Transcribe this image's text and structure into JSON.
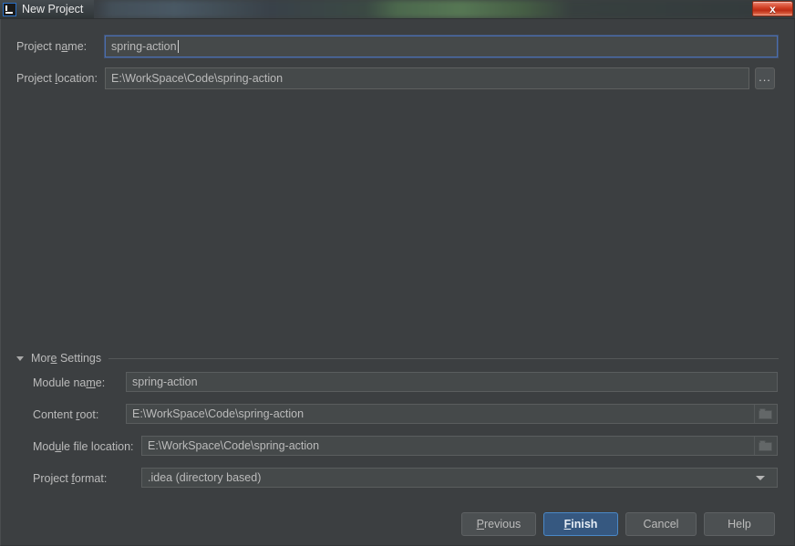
{
  "window": {
    "title": "New Project",
    "app_icon": "intellij-idea-icon",
    "close_label": "x",
    "colors": {
      "dialog_bg": "#3c3f41",
      "field_bg": "#45494a",
      "text": "#bbbbbb",
      "focus_border": "#4b6eaf",
      "primary_button": "#365880",
      "close_button": "#cf3b21"
    }
  },
  "top_form": {
    "project_name": {
      "label_before": "Project n",
      "label_mnemonic": "a",
      "label_after": "me:",
      "label_full": "Project name:",
      "value": "spring-action",
      "focused": true
    },
    "project_location": {
      "label_before": "Project ",
      "label_mnemonic": "l",
      "label_after": "ocation:",
      "label_full": "Project location:",
      "value": "E:\\WorkSpace\\Code\\spring-action",
      "browse_label": "...",
      "browse_icon": "ellipsis-icon"
    }
  },
  "more_settings": {
    "label_before": "Mor",
    "label_mnemonic": "e",
    "label_after": " Settings",
    "label_full": "More Settings",
    "expanded": true,
    "toggle_icon": "chevron-down-icon",
    "fields": {
      "module_name": {
        "label_before": "Module na",
        "label_mnemonic": "m",
        "label_after": "e:",
        "label_full": "Module name:",
        "value": "spring-action"
      },
      "content_root": {
        "label_before": "Content ",
        "label_mnemonic": "r",
        "label_after": "oot:",
        "label_full": "Content root:",
        "value": "E:\\WorkSpace\\Code\\spring-action",
        "browse_icon": "folder-icon"
      },
      "module_file_location": {
        "label_before": "Mod",
        "label_mnemonic": "u",
        "label_after": "le file location:",
        "label_full": "Module file location:",
        "value": "E:\\WorkSpace\\Code\\spring-action",
        "browse_icon": "folder-icon"
      },
      "project_format": {
        "label_before": "Project ",
        "label_mnemonic": "f",
        "label_after": "ormat:",
        "label_full": "Project format:",
        "value": ".idea (directory based)",
        "dropdown_icon": "chevron-down-icon",
        "options": [
          ".idea (directory based)"
        ]
      }
    }
  },
  "footer": {
    "previous": {
      "label_before": "",
      "label_mnemonic": "P",
      "label_after": "revious",
      "label_full": "Previous"
    },
    "finish": {
      "label_before": "",
      "label_mnemonic": "F",
      "label_after": "inish",
      "label_full": "Finish",
      "primary": true
    },
    "cancel": {
      "label_full": "Cancel"
    },
    "help": {
      "label_full": "Help"
    }
  }
}
